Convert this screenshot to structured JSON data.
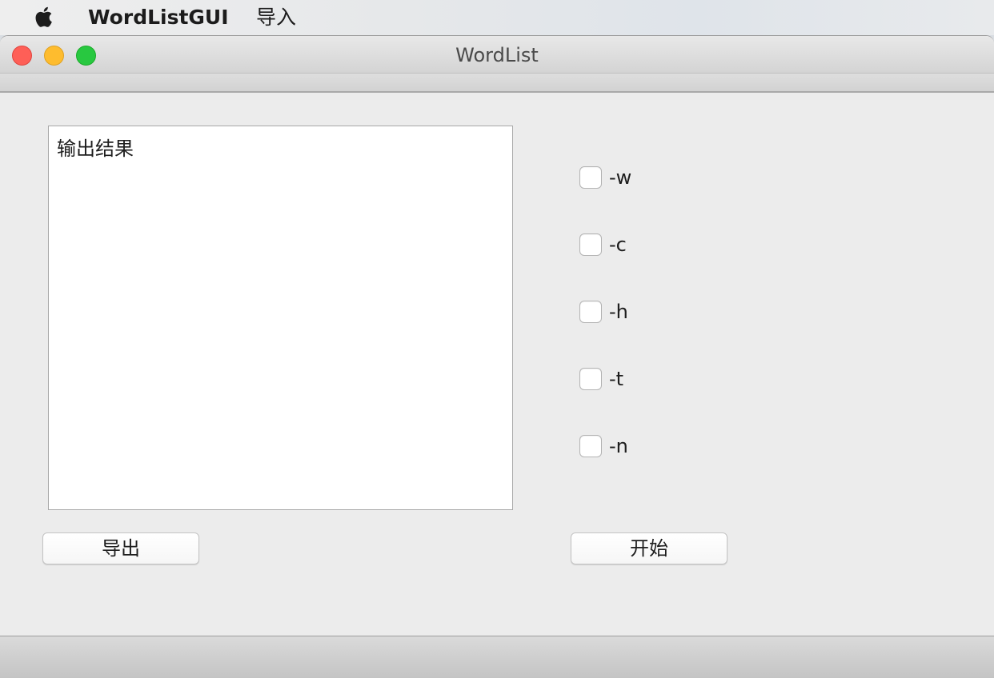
{
  "menubar": {
    "apple_icon": "apple-logo",
    "app_name": "WordListGUI",
    "items": [
      {
        "label": "导入"
      }
    ]
  },
  "window": {
    "title": "WordList",
    "controls": [
      "close",
      "minimize",
      "maximize"
    ]
  },
  "output": {
    "text": "输出结果"
  },
  "options": [
    {
      "label": "-w",
      "checked": false
    },
    {
      "label": "-c",
      "checked": false
    },
    {
      "label": "-h",
      "checked": false
    },
    {
      "label": "-t",
      "checked": false
    },
    {
      "label": "-n",
      "checked": false
    }
  ],
  "buttons": {
    "export_label": "导出",
    "start_label": "开始"
  },
  "colors": {
    "close": "#fe5f57",
    "minimize": "#febc2e",
    "maximize": "#28c840",
    "window_bg": "#ececec"
  }
}
